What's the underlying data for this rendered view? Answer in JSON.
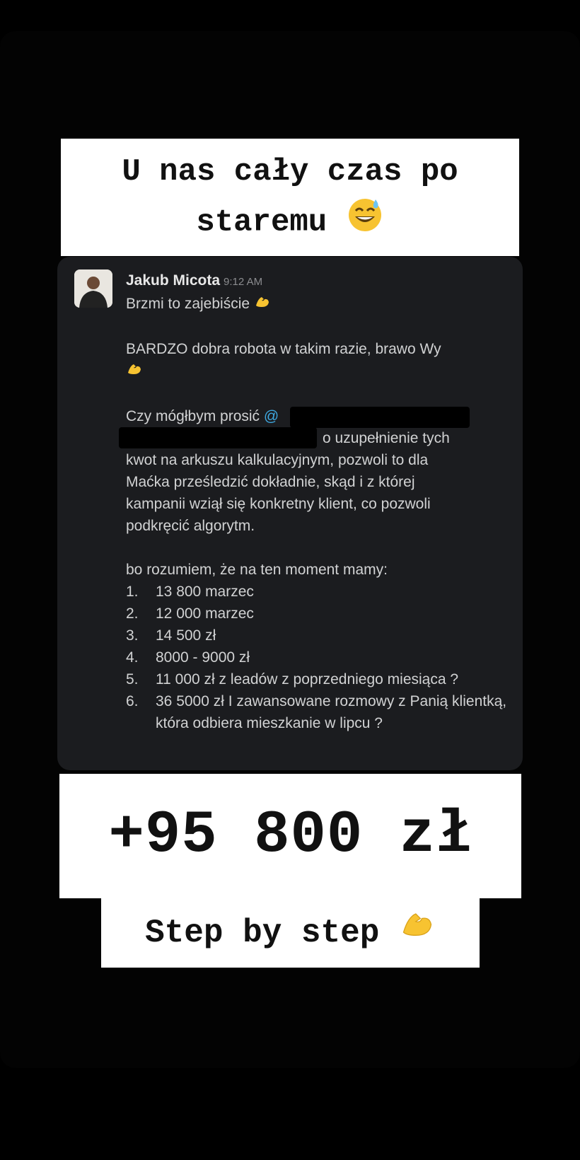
{
  "captions": {
    "top_line1": "U nas cały czas po",
    "top_line2": "staremu",
    "top_emoji": "sweat-smile-emoji",
    "total": "+95 800 zł",
    "step": "Step by step",
    "step_emoji": "flexed-biceps-emoji"
  },
  "message": {
    "author": "Jakub Micota",
    "time": "9:12 AM",
    "line1": "Brzmi to zajebiście",
    "line2": "BARDZO dobra robota w takim razie, brawo Wy",
    "line3_start": "Czy mógłbym prosić",
    "mention_prefix": "@",
    "line3_end": "o uzupełnienie tych",
    "line4": "kwot na arkuszu kalkulacyjnym, pozwoli to dla",
    "line5": "Maćka prześledzić dokładnie, skąd i z której",
    "line6": "kampanii wziął się konkretny klient, co pozwoli",
    "line7": "podkręcić algorytm.",
    "list_intro": "bo rozumiem, że na ten moment mamy:",
    "list": [
      {
        "num": "1.",
        "text": "13 800 marzec"
      },
      {
        "num": "2.",
        "text": "12 000 marzec"
      },
      {
        "num": "3.",
        "text": "14 500 zł"
      },
      {
        "num": "4.",
        "text": "8000 - 9000 zł"
      },
      {
        "num": "5.",
        "text": "11 000 zł z leadów z poprzedniego miesiąca ?"
      },
      {
        "num": "6.",
        "text": "36 5000 zł I zawansowane rozmowy z Panią klientką, która odbiera mieszkanie w lipcu ?"
      }
    ]
  },
  "colors": {
    "background": "#000000",
    "message_bg": "#1b1c1f",
    "mention": "#3ea8e0",
    "caption_bg": "#ffffff"
  }
}
